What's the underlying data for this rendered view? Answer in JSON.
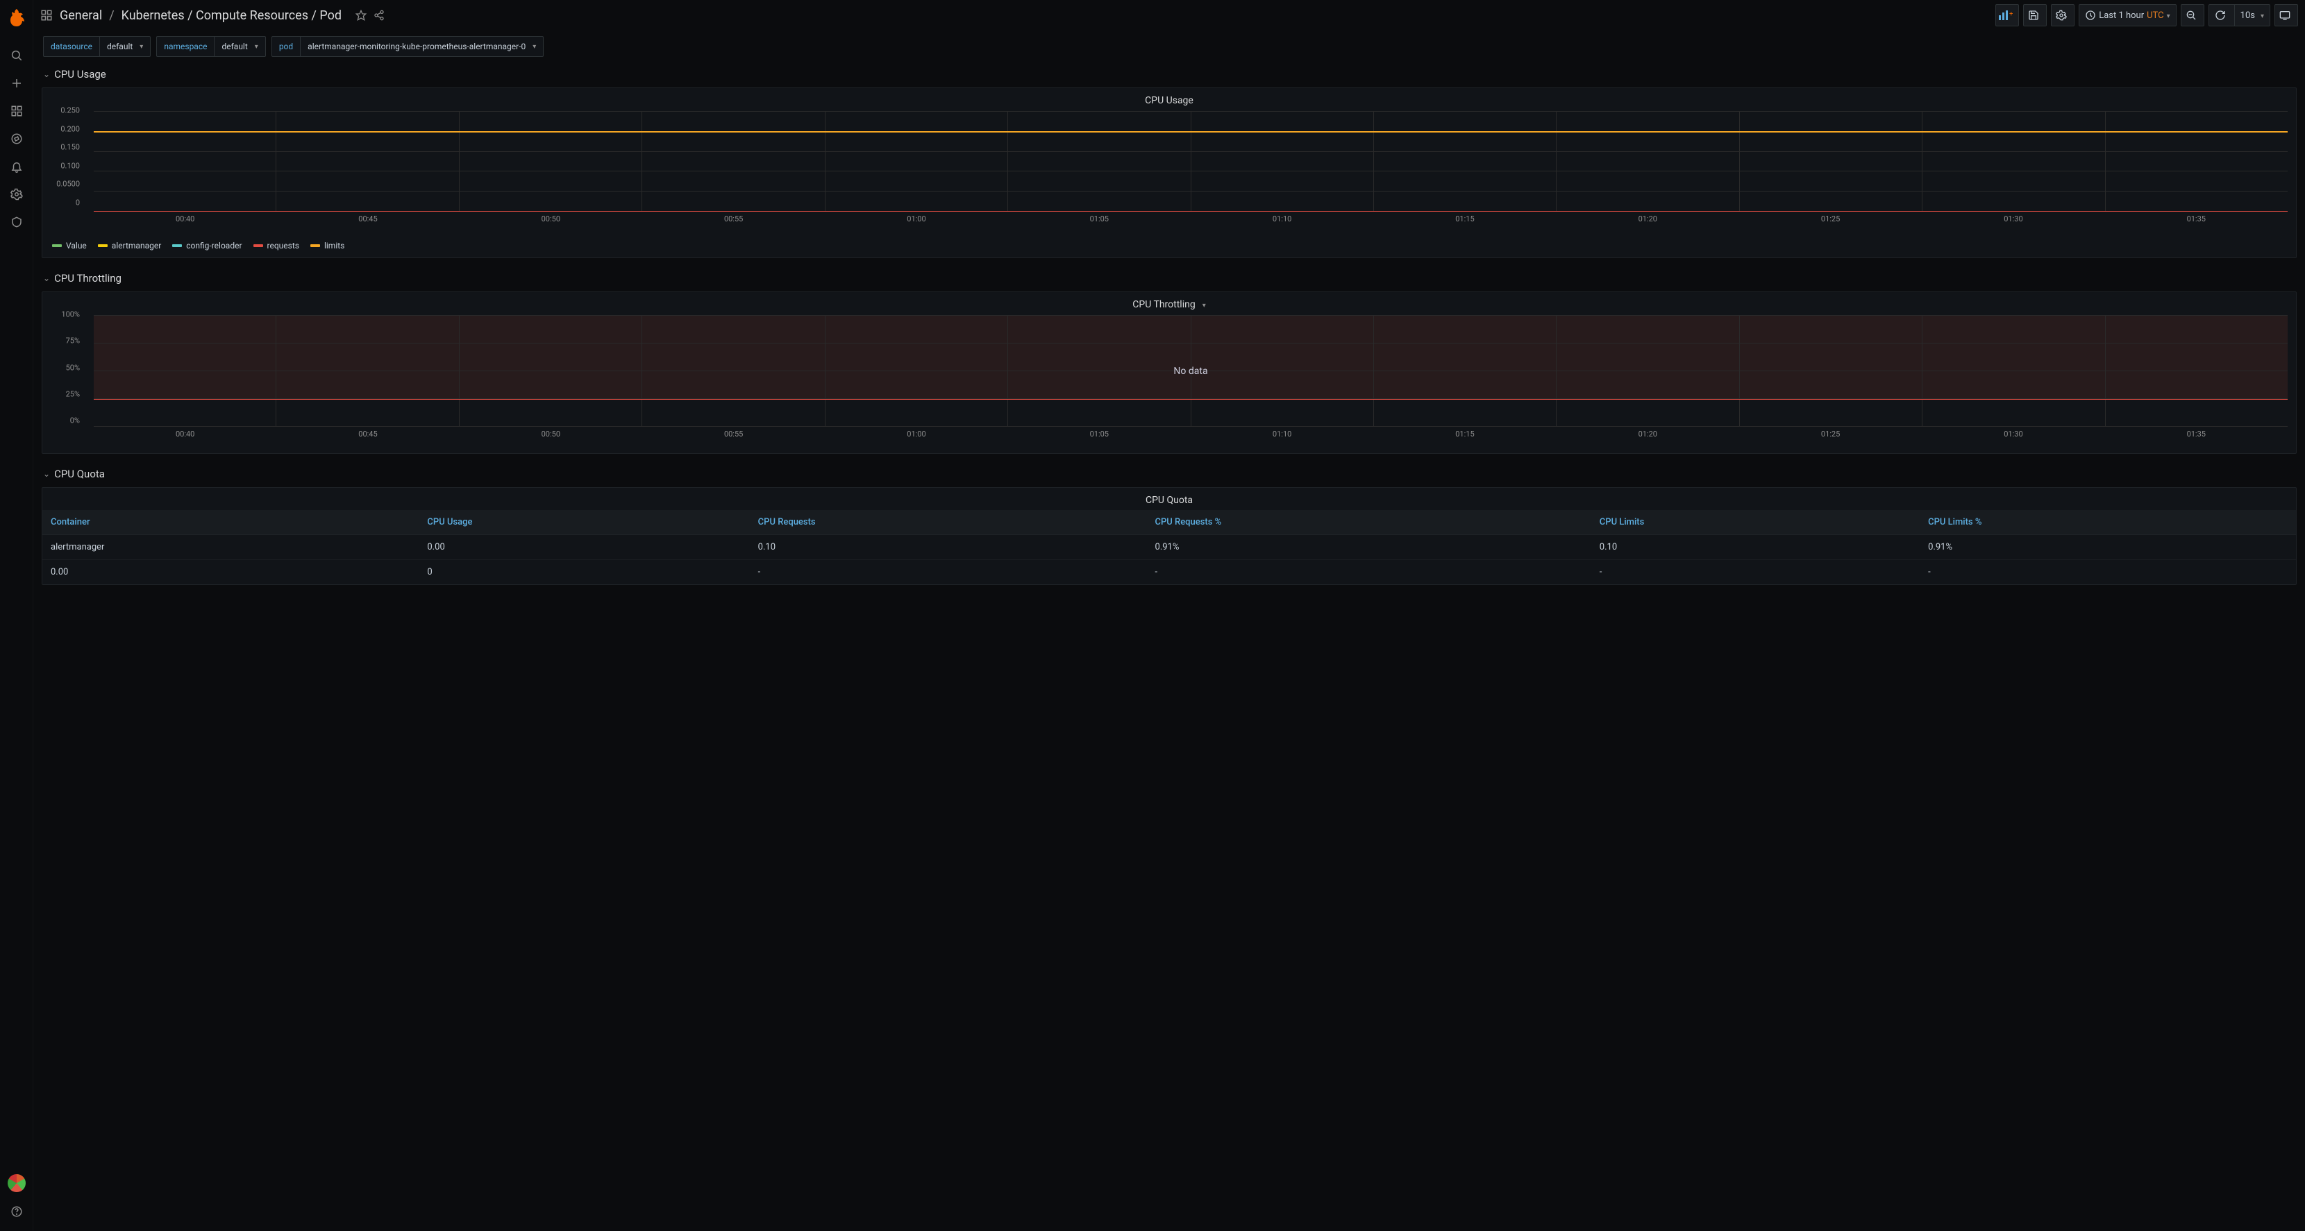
{
  "breadcrumb": {
    "group": "General",
    "title": "Kubernetes / Compute Resources / Pod"
  },
  "toolbar": {
    "time_label": "Last 1 hour",
    "time_tz": "UTC",
    "refresh_label": "10s"
  },
  "variables": {
    "datasource": {
      "label": "datasource",
      "value": "default"
    },
    "namespace": {
      "label": "namespace",
      "value": "default"
    },
    "pod": {
      "label": "pod",
      "value": "alertmanager-monitoring-kube-prometheus-alertmanager-0"
    }
  },
  "rows": {
    "cpu_usage": "CPU Usage",
    "cpu_throttling": "CPU Throttling",
    "cpu_quota": "CPU Quota"
  },
  "panels": {
    "cpu_usage": {
      "title": "CPU Usage",
      "y_ticks": [
        "0.250",
        "0.200",
        "0.150",
        "0.100",
        "0.0500",
        "0"
      ],
      "x_ticks": [
        "00:40",
        "00:45",
        "00:50",
        "00:55",
        "01:00",
        "01:05",
        "01:10",
        "01:15",
        "01:20",
        "01:25",
        "01:30",
        "01:35"
      ],
      "legend": [
        {
          "name": "Value",
          "color": "#73bf69"
        },
        {
          "name": "alertmanager",
          "color": "#f2cc0c"
        },
        {
          "name": "config-reloader",
          "color": "#5ac8c8"
        },
        {
          "name": "requests",
          "color": "#e24d42"
        },
        {
          "name": "limits",
          "color": "#f5a623"
        }
      ]
    },
    "cpu_throttling": {
      "title": "CPU Throttling",
      "nodata": "No data",
      "y_ticks": [
        "100%",
        "75%",
        "50%",
        "25%",
        "0%"
      ],
      "x_ticks": [
        "00:40",
        "00:45",
        "00:50",
        "00:55",
        "01:00",
        "01:05",
        "01:10",
        "01:15",
        "01:20",
        "01:25",
        "01:30",
        "01:35"
      ]
    },
    "cpu_quota": {
      "title": "CPU Quota",
      "columns": [
        "Container",
        "CPU Usage",
        "CPU Requests",
        "CPU Requests %",
        "CPU Limits",
        "CPU Limits %"
      ],
      "rows": [
        {
          "container": "alertmanager",
          "usage": "0.00",
          "requests": "0.10",
          "requests_pct": "0.91%",
          "limits": "0.10",
          "limits_pct": "0.91%"
        },
        {
          "container": "0.00",
          "usage": "0",
          "requests": "-",
          "requests_pct": "-",
          "limits": "-",
          "limits_pct": "-"
        }
      ]
    }
  },
  "chart_data": [
    {
      "panel": "CPU Usage",
      "type": "line",
      "x": [
        "00:40",
        "00:45",
        "00:50",
        "00:55",
        "01:00",
        "01:05",
        "01:10",
        "01:15",
        "01:20",
        "01:25",
        "01:30",
        "01:35"
      ],
      "ylim": [
        0,
        0.25
      ],
      "ylabel": "",
      "xlabel": "",
      "series": [
        {
          "name": "Value",
          "values": [
            0.0,
            0.0,
            0.0,
            0.0,
            0.0,
            0.0,
            0.0,
            0.0,
            0.0,
            0.0,
            0.0,
            0.0
          ]
        },
        {
          "name": "alertmanager",
          "values": [
            0.0,
            0.0,
            0.0,
            0.0,
            0.0,
            0.0,
            0.0,
            0.0,
            0.0,
            0.0,
            0.0,
            0.0
          ]
        },
        {
          "name": "config-reloader",
          "values": [
            0.0,
            0.0,
            0.0,
            0.0,
            0.0,
            0.0,
            0.0,
            0.0,
            0.0,
            0.0,
            0.0,
            0.0
          ]
        },
        {
          "name": "requests",
          "values": [
            0.0,
            0.0,
            0.0,
            0.0,
            0.0,
            0.0,
            0.0,
            0.0,
            0.0,
            0.0,
            0.0,
            0.0
          ]
        },
        {
          "name": "limits",
          "values": [
            0.2,
            0.2,
            0.2,
            0.2,
            0.2,
            0.2,
            0.2,
            0.2,
            0.2,
            0.2,
            0.2,
            0.2
          ]
        }
      ]
    },
    {
      "panel": "CPU Throttling",
      "type": "line",
      "x": [
        "00:40",
        "00:45",
        "00:50",
        "00:55",
        "01:00",
        "01:05",
        "01:10",
        "01:15",
        "01:20",
        "01:25",
        "01:30",
        "01:35"
      ],
      "ylim": [
        0,
        100
      ],
      "ylabel": "%",
      "series": [],
      "note": "No data",
      "threshold_fill_above": 25
    }
  ]
}
